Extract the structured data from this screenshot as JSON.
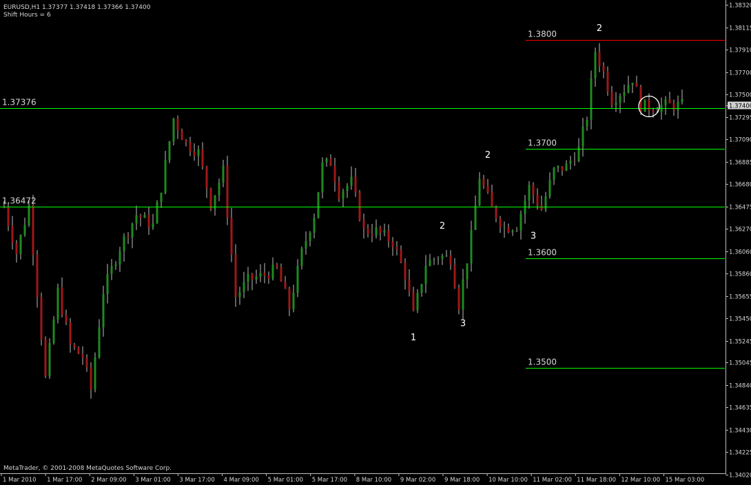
{
  "chart_data": {
    "type": "candlestick",
    "symbol_info": "EURUSD,H1  1.37377 1.37418 1.37366 1.37400",
    "subtitle": "Shift Hours = 6",
    "copyright": "MetaTrader, © 2001-2008 MetaQuotes Software Corp.",
    "ylim": [
      1.3402,
      1.3832
    ],
    "y_ticks": [
      1.3832,
      1.38115,
      1.3791,
      1.377,
      1.375,
      1.374,
      1.37295,
      1.3709,
      1.36885,
      1.3668,
      1.36475,
      1.3627,
      1.3606,
      1.3586,
      1.35655,
      1.3545,
      1.35245,
      1.35045,
      1.3484,
      1.34635,
      1.3443,
      1.34225,
      1.3402
    ],
    "y_tick_labels": [
      "1.38320",
      "1.38115",
      "1.37910",
      "1.37700",
      "1.37500",
      "1.37400",
      "1.37295",
      "1.37090",
      "1.36885",
      "1.36680",
      "1.36475",
      "1.36270",
      "1.36060",
      "1.35860",
      "1.35655",
      "1.35450",
      "1.35245",
      "1.35045",
      "1.34840",
      "1.34635",
      "1.34430",
      "1.34225",
      "1.34020"
    ],
    "current_price_label": "1.37400",
    "x_tick_labels": [
      "1 Mar 2010",
      "1 Mar 17:00",
      "2 Mar 09:00",
      "3 Mar 01:00",
      "3 Mar 17:00",
      "4 Mar 09:00",
      "5 Mar 01:00",
      "5 Mar 17:00",
      "8 Mar 10:00",
      "9 Mar 02:00",
      "9 Mar 18:00",
      "10 Mar 10:00",
      "11 Mar 02:00",
      "11 Mar 18:00",
      "12 Mar 10:00",
      "15 Mar 03:00"
    ],
    "bar_count": 165,
    "key_points": [
      {
        "bar": 0,
        "price": 1.3647
      },
      {
        "bar": 3,
        "price": 1.3605
      },
      {
        "bar": 6,
        "price": 1.3648
      },
      {
        "bar": 10,
        "price": 1.349
      },
      {
        "bar": 13,
        "price": 1.357
      },
      {
        "bar": 16,
        "price": 1.352
      },
      {
        "bar": 19,
        "price": 1.351
      },
      {
        "bar": 21,
        "price": 1.348
      },
      {
        "bar": 24,
        "price": 1.357
      },
      {
        "bar": 28,
        "price": 1.361
      },
      {
        "bar": 32,
        "price": 1.364
      },
      {
        "bar": 36,
        "price": 1.363
      },
      {
        "bar": 38,
        "price": 1.3665
      },
      {
        "bar": 41,
        "price": 1.3728
      },
      {
        "bar": 44,
        "price": 1.3705
      },
      {
        "bar": 47,
        "price": 1.3697
      },
      {
        "bar": 50,
        "price": 1.365
      },
      {
        "bar": 53,
        "price": 1.368
      },
      {
        "bar": 56,
        "price": 1.3565
      },
      {
        "bar": 59,
        "price": 1.358
      },
      {
        "bar": 63,
        "price": 1.3585
      },
      {
        "bar": 66,
        "price": 1.359
      },
      {
        "bar": 69,
        "price": 1.3555
      },
      {
        "bar": 72,
        "price": 1.3605
      },
      {
        "bar": 75,
        "price": 1.364
      },
      {
        "bar": 77,
        "price": 1.3685
      },
      {
        "bar": 79,
        "price": 1.3688
      },
      {
        "bar": 81,
        "price": 1.366
      },
      {
        "bar": 84,
        "price": 1.367
      },
      {
        "bar": 87,
        "price": 1.3625
      },
      {
        "bar": 90,
        "price": 1.3625
      },
      {
        "bar": 94,
        "price": 1.3615
      },
      {
        "bar": 97,
        "price": 1.3585
      },
      {
        "bar": 99,
        "price": 1.3548
      },
      {
        "bar": 102,
        "price": 1.3595
      },
      {
        "bar": 105,
        "price": 1.3602
      },
      {
        "bar": 108,
        "price": 1.36
      },
      {
        "bar": 110,
        "price": 1.3558
      },
      {
        "bar": 113,
        "price": 1.362
      },
      {
        "bar": 115,
        "price": 1.3675
      },
      {
        "bar": 118,
        "price": 1.3645
      },
      {
        "bar": 121,
        "price": 1.3628
      },
      {
        "bar": 124,
        "price": 1.363
      },
      {
        "bar": 127,
        "price": 1.3665
      },
      {
        "bar": 130,
        "price": 1.3645
      },
      {
        "bar": 133,
        "price": 1.368
      },
      {
        "bar": 136,
        "price": 1.3684
      },
      {
        "bar": 139,
        "price": 1.37
      },
      {
        "bar": 141,
        "price": 1.373
      },
      {
        "bar": 143,
        "price": 1.379
      },
      {
        "bar": 145,
        "price": 1.377
      },
      {
        "bar": 147,
        "price": 1.3745
      },
      {
        "bar": 150,
        "price": 1.3755
      },
      {
        "bar": 152,
        "price": 1.3765
      },
      {
        "bar": 154,
        "price": 1.374
      },
      {
        "bar": 157,
        "price": 1.3738
      },
      {
        "bar": 160,
        "price": 1.374
      },
      {
        "bar": 164,
        "price": 1.374
      }
    ],
    "horizontal_lines": [
      {
        "label": "1.37376",
        "price": 1.37376,
        "color": "#00ff00",
        "scope": "full"
      },
      {
        "label": "1.36472",
        "price": 1.36472,
        "color": "#00ff00",
        "scope": "full"
      },
      {
        "label": "1.3800",
        "price": 1.38,
        "color": "#ff0000",
        "scope": "right"
      },
      {
        "label": "1.3700",
        "price": 1.37,
        "color": "#00ff00",
        "scope": "right"
      },
      {
        "label": "1.3600",
        "price": 1.36,
        "color": "#00ff00",
        "scope": "right"
      },
      {
        "label": "1.3500",
        "price": 1.35,
        "color": "#00ff00",
        "scope": "right"
      }
    ],
    "wave_labels": [
      {
        "text": "1",
        "bar": 99,
        "price": 1.3525
      },
      {
        "text": "2",
        "bar": 106,
        "price": 1.3627
      },
      {
        "text": "3",
        "bar": 111,
        "price": 1.3538
      },
      {
        "text": "2",
        "bar": 117,
        "price": 1.3692
      },
      {
        "text": "3",
        "bar": 128,
        "price": 1.3618
      },
      {
        "text": "2",
        "bar": 144,
        "price": 1.3808
      }
    ],
    "circle_marker": {
      "bar": 156,
      "price": 1.3739
    },
    "colors": {
      "background": "#000000",
      "bull": "#1f8a1f",
      "bear": "#a01818",
      "wick": "#bfbfbf",
      "axis": "#c0c0c0",
      "text": "#d8d8d8"
    }
  }
}
